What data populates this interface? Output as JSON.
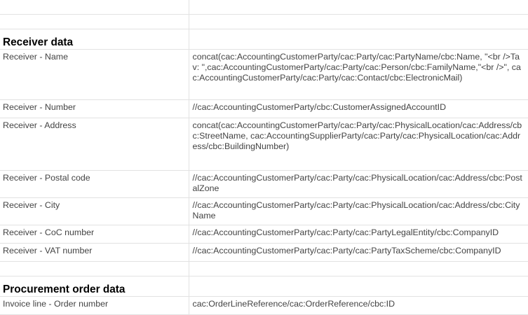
{
  "sections": [
    {
      "title": "Receiver data",
      "rows": [
        {
          "label": "Receiver - Name",
          "value": "concat(cac:AccountingCustomerParty/cac:Party/cac:PartyName/cbc:Name, \"<br />Tav: \",cac:AccountingCustomerParty/cac:Party/cac:Person/cbc:FamilyName,\"<br />\", cac:AccountingCustomerParty/cac:Party/cac:Contact/cbc:ElectronicMail)"
        },
        {
          "label": "Receiver - Number",
          "value": "//cac:AccountingCustomerParty/cbc:CustomerAssignedAccountID"
        },
        {
          "label": "Receiver - Address",
          "value": "concat(cac:AccountingCustomerParty/cac:Party/cac:PhysicalLocation/cac:Address/cbc:StreetName, cac:AccountingSupplierParty/cac:Party/cac:PhysicalLocation/cac:Address/cbc:BuildingNumber)"
        },
        {
          "label": "Receiver - Postal code",
          "value": "//cac:AccountingCustomerParty/cac:Party/cac:PhysicalLocation/cac:Address/cbc:PostalZone"
        },
        {
          "label": "Receiver - City",
          "value": "//cac:AccountingCustomerParty/cac:Party/cac:PhysicalLocation/cac:Address/cbc:CityName"
        },
        {
          "label": "Receiver - CoC number",
          "value": "//cac:AccountingCustomerParty/cac:Party/cac:PartyLegalEntity/cbc:CompanyID"
        },
        {
          "label": "Receiver - VAT number",
          "value": "//cac:AccountingCustomerParty/cac:Party/cac:PartyTaxScheme/cbc:CompanyID"
        }
      ]
    },
    {
      "title": "Procurement order data",
      "rows": [
        {
          "label": "Invoice line - Order number",
          "value": "cac:OrderLineReference/cac:OrderReference/cbc:ID"
        }
      ]
    }
  ]
}
